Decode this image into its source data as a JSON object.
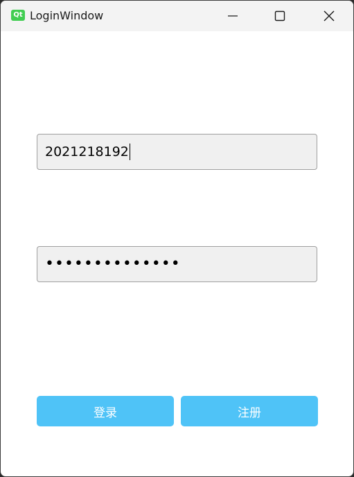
{
  "window": {
    "title": "LoginWindow",
    "app_icon_text": "Qt",
    "app_icon": "qt-logo-icon",
    "controls": [
      "minimize-icon",
      "maximize-icon",
      "close-icon"
    ]
  },
  "form": {
    "username_value": "2021218192",
    "password_masked": "••••••••••••••",
    "password_length": 14
  },
  "buttons": {
    "login_label": "登录",
    "register_label": "注册"
  },
  "colors": {
    "button_bg": "#4fc3f7",
    "button_text": "#ffffff",
    "field_bg": "#f0f0f0",
    "titlebar_bg": "#f3f3f3",
    "qt_green": "#41cd52"
  }
}
